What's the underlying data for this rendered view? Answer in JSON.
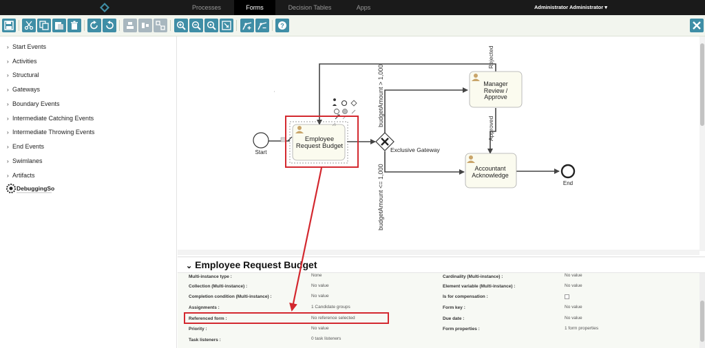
{
  "nav": {
    "tabs": [
      {
        "label": "Processes"
      },
      {
        "label": "Forms"
      },
      {
        "label": "Decision Tables"
      },
      {
        "label": "Apps"
      }
    ],
    "user_label": "Administrator Administrator",
    "user_icon": "chevron-down-icon"
  },
  "toolbar": {
    "buttons": [
      "save-icon",
      "cut-icon",
      "copy-icon",
      "paste-icon",
      "delete-icon",
      "redo-icon",
      "undo-icon",
      "align-icon",
      "distribute-icon",
      "layout-icon",
      "zoom-in-icon",
      "zoom-out-icon",
      "zoom-actual-icon",
      "zoom-fit-icon",
      "bend-add-icon",
      "bend-remove-icon",
      "help-icon",
      "close-icon"
    ]
  },
  "palette": {
    "items": [
      {
        "label": "Start Events"
      },
      {
        "label": "Activities"
      },
      {
        "label": "Structural"
      },
      {
        "label": "Gateways"
      },
      {
        "label": "Boundary Events"
      },
      {
        "label": "Intermediate Catching Events"
      },
      {
        "label": "Intermediate Throwing Events"
      },
      {
        "label": "End Events"
      },
      {
        "label": "Swimlanes"
      },
      {
        "label": "Artifacts"
      }
    ],
    "watermark": "DebuggingSoft"
  },
  "diagram": {
    "start_label": "Start",
    "end_label": "End",
    "task_employee_line1": "Employee",
    "task_employee_line2": "Request Budget",
    "task_manager_line1": "Manager",
    "task_manager_line2": "Review /",
    "task_manager_line3": "Approve",
    "task_accountant_line1": "Accountant",
    "task_accountant_line2": "Acknowledge",
    "gateway_label": "Exclusive Gateway",
    "flow_gt": "budgetAmount > 1,000",
    "flow_lte": "budgetAmount <= 1,000",
    "flow_rejected": "Rejected",
    "flow_approved": "Approved"
  },
  "properties": {
    "title": "Employee Request Budget",
    "left_labels": [
      "Multi-instance type :",
      "Collection (Multi-instance) :",
      "Completion condition (Multi-instance) :",
      "Assignments :",
      "Referenced form :",
      "Priority :",
      "Task listeners :"
    ],
    "left_values": [
      "None",
      "No value",
      "No value",
      "1 Candidate groups",
      "No reference selected",
      "No value",
      "0 task listeners"
    ],
    "right_labels": [
      "Cardinality (Multi-instance) :",
      "Element variable (Multi-instance) :",
      "Is for compensation :",
      "Form key :",
      "Due date :",
      "Form properties :"
    ],
    "right_values": [
      "No value",
      "No value",
      "",
      "No value",
      "No value",
      "1 form properties"
    ]
  },
  "colors": {
    "accent": "#3f8ea6",
    "annotation": "#d3272e",
    "nav_bg": "#1a1a1a",
    "task_fill": "#fbfbef"
  }
}
